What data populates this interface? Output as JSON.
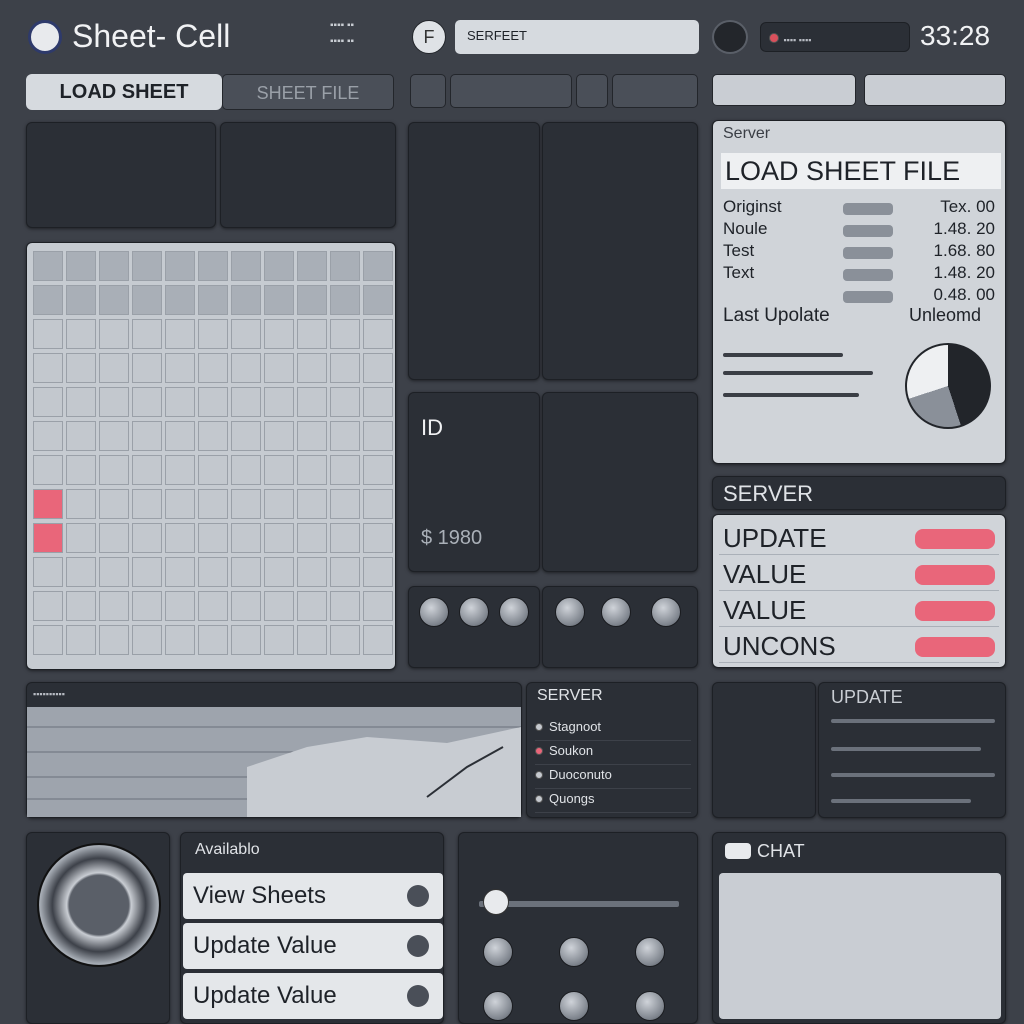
{
  "header": {
    "app_title": "Sheet-  Cell",
    "search_value": "SERFEET",
    "clock": "33:28"
  },
  "toolbar": {
    "load_sheet_label": "LOAD SHEET",
    "sheet_file_label": "SHEET FILE"
  },
  "server_panel": {
    "heading": "Server",
    "title": "LOAD SHEET FILE",
    "rows": [
      {
        "label": "Originst",
        "value": "Tex. 00"
      },
      {
        "label": "Noule",
        "value": "1.48. 20"
      },
      {
        "label": "Test",
        "value": "1.68. 80"
      },
      {
        "label": "Text",
        "value": "1.48. 20"
      },
      {
        "label": "",
        "value": "0.48. 00"
      }
    ],
    "last_update_label": "Last Upolate",
    "last_update_value": "Unleomd"
  },
  "id_panel": {
    "label": "ID",
    "amount": "$ 1980"
  },
  "server_actions": {
    "heading": "SERVER",
    "rows": [
      {
        "label": "UPDATE"
      },
      {
        "label": "VALUE"
      },
      {
        "label": "VALUE"
      },
      {
        "label": "UNCONS"
      }
    ]
  },
  "server_list": {
    "heading": "SERVER",
    "items": [
      "Stagnoot",
      "Soukon",
      "Duoconuto",
      "Quongs"
    ]
  },
  "update_panel": {
    "heading": "UPDATE"
  },
  "available_panel": {
    "heading": "Availablo",
    "items": [
      "View Sheets",
      "Update Value",
      "Update Value"
    ]
  },
  "chat_panel": {
    "heading": "CHAT"
  },
  "colors": {
    "accent_red": "#e9667a",
    "panel": "#2b2f36",
    "light": "#d6dadf"
  },
  "icons": [
    "logo-icon",
    "font-icon",
    "camera-icon",
    "settings-icon",
    "grid-icon",
    "chat-icon"
  ]
}
